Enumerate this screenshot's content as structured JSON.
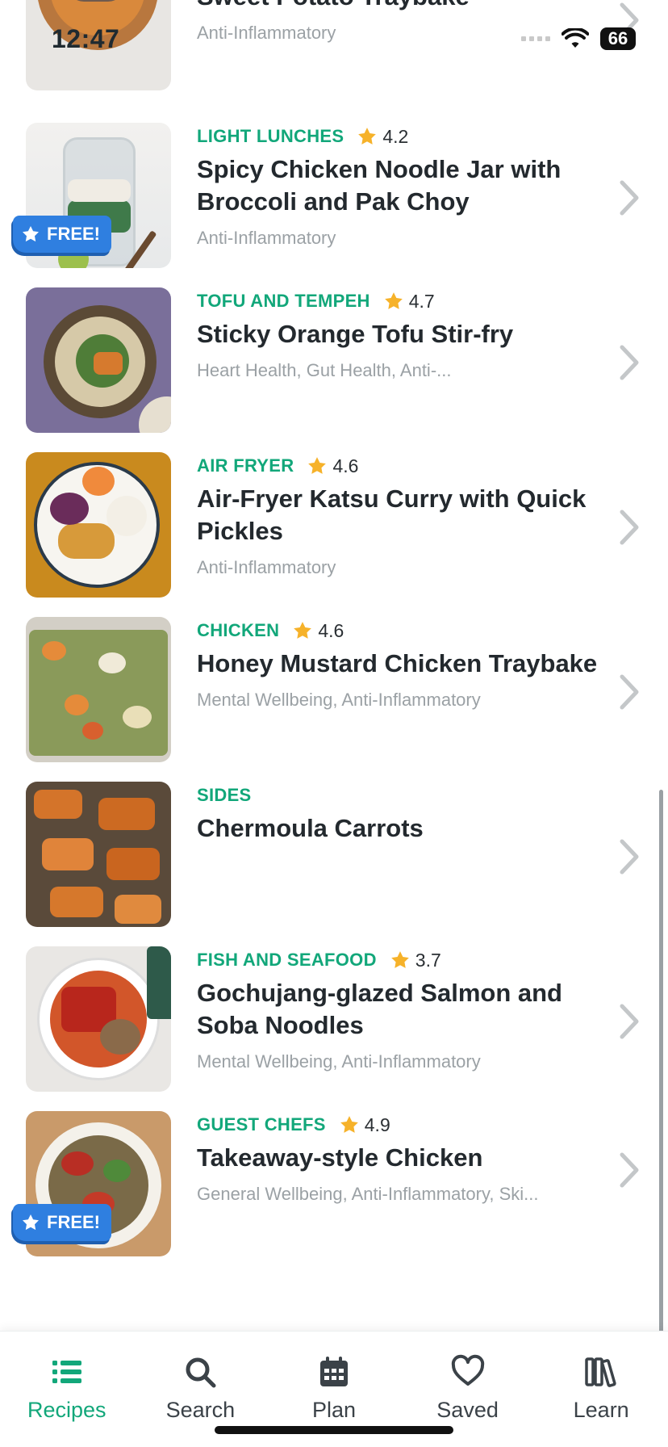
{
  "status_bar": {
    "time": "12:47",
    "battery": "66"
  },
  "colors": {
    "accent": "#12a77a",
    "star": "#f6b22a",
    "free_badge": "#2f7fe0",
    "muted": "#9ba1a5"
  },
  "badges": {
    "free": "FREE!"
  },
  "recipes": [
    {
      "category": "",
      "rating": "",
      "title": "Cinnamon and Sumac Cod with Sweet Potato Traybake",
      "tags": "Anti-Inflammatory",
      "free": false
    },
    {
      "category": "LIGHT LUNCHES",
      "rating": "4.2",
      "title": "Spicy Chicken Noodle Jar with Broccoli and Pak Choy",
      "tags": "Anti-Inflammatory",
      "free": true
    },
    {
      "category": "TOFU AND TEMPEH",
      "rating": "4.7",
      "title": "Sticky Orange Tofu Stir-fry",
      "tags": "Heart Health, Gut Health, Anti-...",
      "free": false
    },
    {
      "category": "AIR FRYER",
      "rating": "4.6",
      "title": "Air-Fryer Katsu Curry with Quick Pickles",
      "tags": "Anti-Inflammatory",
      "free": false
    },
    {
      "category": "CHICKEN",
      "rating": "4.6",
      "title": "Honey Mustard Chicken Traybake",
      "tags": "Mental Wellbeing, Anti-Inflammatory",
      "free": false
    },
    {
      "category": "SIDES",
      "rating": "",
      "title": "Chermoula Carrots",
      "tags": "",
      "free": false
    },
    {
      "category": "FISH AND SEAFOOD",
      "rating": "3.7",
      "title": "Gochujang-glazed Salmon and Soba Noodles",
      "tags": "Mental Wellbeing, Anti-Inflammatory",
      "free": false
    },
    {
      "category": "GUEST CHEFS",
      "rating": "4.9",
      "title": "Takeaway-style Chicken",
      "tags": "General Wellbeing, Anti-Inflammatory, Ski...",
      "free": true
    }
  ],
  "tabs": [
    {
      "label": "Recipes",
      "icon": "list-icon",
      "active": true
    },
    {
      "label": "Search",
      "icon": "search-icon",
      "active": false
    },
    {
      "label": "Plan",
      "icon": "calendar-icon",
      "active": false
    },
    {
      "label": "Saved",
      "icon": "heart-icon",
      "active": false
    },
    {
      "label": "Learn",
      "icon": "books-icon",
      "active": false
    }
  ]
}
